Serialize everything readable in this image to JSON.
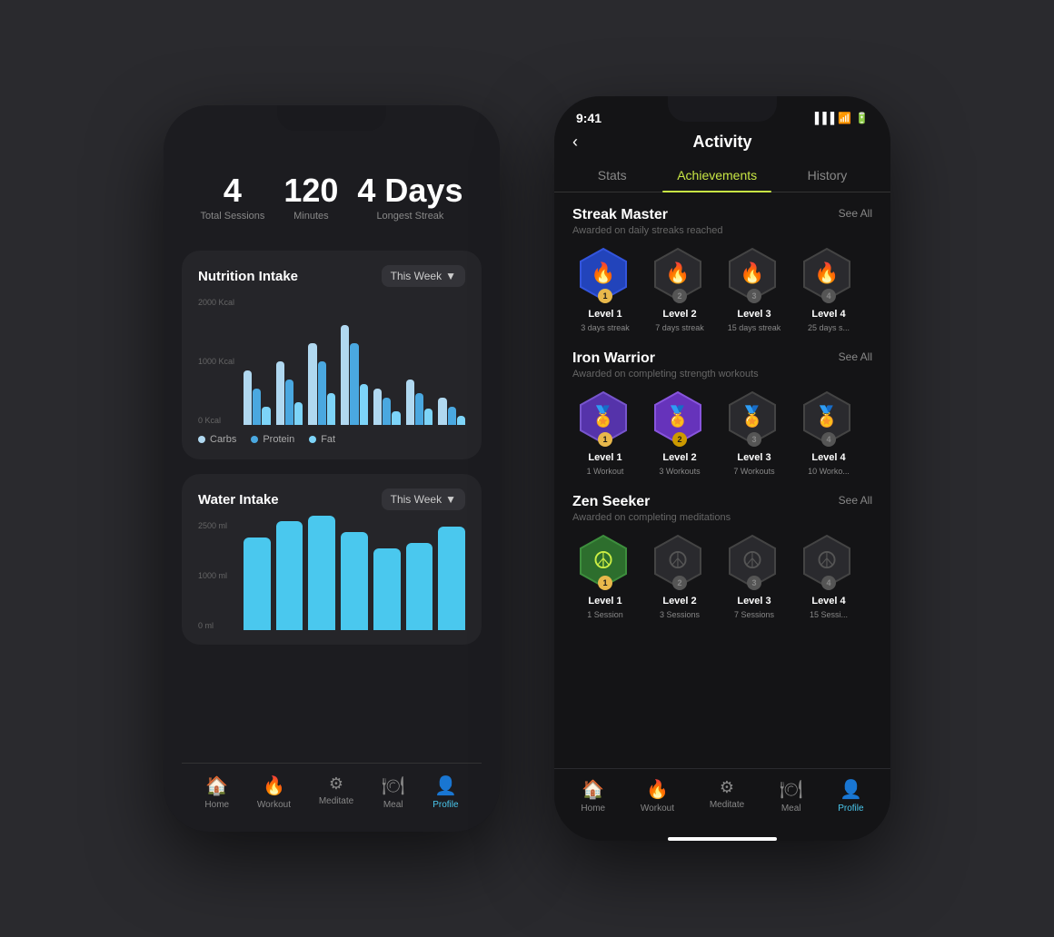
{
  "left_phone": {
    "stats": [
      {
        "value": "4",
        "label": "Total Sessions"
      },
      {
        "value": "120",
        "label": "Minutes"
      },
      {
        "value": "4 Days",
        "label": "Longest Streak"
      }
    ],
    "nutrition": {
      "title": "Nutrition Intake",
      "filter": "This Week",
      "y_labels": [
        "2000 Kcal",
        "1000 Kcal",
        "0 Kcal"
      ],
      "legend": [
        {
          "label": "Carbs",
          "color": "#b0d8f0"
        },
        {
          "label": "Protein",
          "color": "#4aa8e0"
        },
        {
          "label": "Fat",
          "color": "#7dd4f8"
        }
      ],
      "bars": [
        {
          "carb": 60,
          "protein": 40,
          "fat": 20
        },
        {
          "carb": 70,
          "protein": 50,
          "fat": 25
        },
        {
          "carb": 90,
          "protein": 70,
          "fat": 35
        },
        {
          "carb": 110,
          "protein": 90,
          "fat": 45
        },
        {
          "carb": 40,
          "protein": 30,
          "fat": 15
        },
        {
          "carb": 50,
          "protein": 35,
          "fat": 18
        },
        {
          "carb": 30,
          "protein": 20,
          "fat": 10
        }
      ]
    },
    "water": {
      "title": "Water Intake",
      "filter": "This Week",
      "y_labels": [
        "2500 ml",
        "1000 ml",
        "0 ml"
      ],
      "bars": [
        85,
        100,
        105,
        90,
        75,
        80,
        95
      ]
    },
    "nav": [
      {
        "icon": "🏠",
        "label": "Home",
        "active": false
      },
      {
        "icon": "🔥",
        "label": "Workout",
        "active": false
      },
      {
        "icon": "⚙️",
        "label": "Meditate",
        "active": false
      },
      {
        "icon": "🍽",
        "label": "Meal",
        "active": false
      },
      {
        "icon": "👤",
        "label": "Profile",
        "active": true
      }
    ]
  },
  "right_phone": {
    "status_time": "9:41",
    "back_label": "‹",
    "page_title": "Activity",
    "tabs": [
      {
        "label": "Stats",
        "active": false
      },
      {
        "label": "Achievements",
        "active": true
      },
      {
        "label": "History",
        "active": false
      }
    ],
    "sections": [
      {
        "title": "Streak Master",
        "subtitle": "Awarded on daily streaks reached",
        "see_all": "See All",
        "badges": [
          {
            "level": "Level 1",
            "sublabel": "3 days streak",
            "number": "1",
            "active": true,
            "color": "#3a5fcc",
            "icon": "🔥"
          },
          {
            "level": "Level 2",
            "sublabel": "7 days streak",
            "number": "2",
            "active": false,
            "color": "#333",
            "icon": "🔥"
          },
          {
            "level": "Level 3",
            "sublabel": "15 days streak",
            "number": "3",
            "active": false,
            "color": "#333",
            "icon": "🔥"
          },
          {
            "level": "Level 4",
            "sublabel": "25 days s...",
            "number": "4",
            "active": false,
            "color": "#333",
            "icon": "🔥"
          }
        ]
      },
      {
        "title": "Iron Warrior",
        "subtitle": "Awarded on completing strength workouts",
        "see_all": "See All",
        "badges": [
          {
            "level": "Level 1",
            "sublabel": "1 Workout",
            "number": "1",
            "active": true,
            "color": "#5533aa",
            "icon": "🏅"
          },
          {
            "level": "Level 2",
            "sublabel": "3 Workouts",
            "number": "2",
            "active": true,
            "color": "#6633bb",
            "icon": "🏅"
          },
          {
            "level": "Level 3",
            "sublabel": "7 Workouts",
            "number": "3",
            "active": false,
            "color": "#333",
            "icon": "🏅"
          },
          {
            "level": "Level 4",
            "sublabel": "10 Worko...",
            "number": "4",
            "active": false,
            "color": "#333",
            "icon": "🏅"
          }
        ]
      },
      {
        "title": "Zen Seeker",
        "subtitle": "Awarded on completing meditations",
        "see_all": "See All",
        "badges": [
          {
            "level": "Level 1",
            "sublabel": "1 Session",
            "number": "1",
            "active": true,
            "color": "#2d6e2d",
            "icon": "☮"
          },
          {
            "level": "Level 2",
            "sublabel": "3 Sessions",
            "number": "2",
            "active": false,
            "color": "#333",
            "icon": "☮"
          },
          {
            "level": "Level 3",
            "sublabel": "7 Sessions",
            "number": "3",
            "active": false,
            "color": "#333",
            "icon": "☮"
          },
          {
            "level": "Level 4",
            "sublabel": "15 Sessi...",
            "number": "4",
            "active": false,
            "color": "#333",
            "icon": "☮"
          }
        ]
      }
    ],
    "nav": [
      {
        "icon": "🏠",
        "label": "Home",
        "active": false
      },
      {
        "icon": "🔥",
        "label": "Workout",
        "active": false
      },
      {
        "icon": "⚙️",
        "label": "Meditate",
        "active": false
      },
      {
        "icon": "🍽",
        "label": "Meal",
        "active": false
      },
      {
        "icon": "👤",
        "label": "Profile",
        "active": true
      }
    ]
  }
}
